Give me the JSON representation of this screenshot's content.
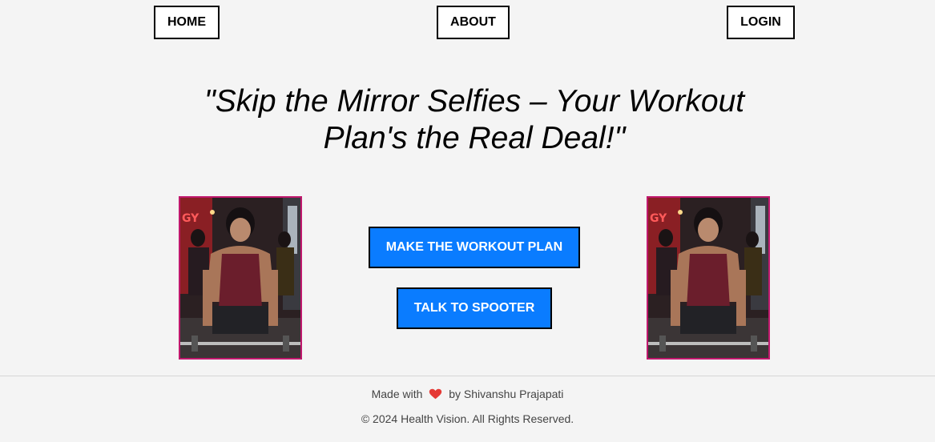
{
  "nav": {
    "home_label": "HOME",
    "about_label": "ABOUT",
    "login_label": "LOGIN"
  },
  "hero": {
    "tagline_line1": "\"Skip the Mirror Selfies – Your Workout",
    "tagline_line2": "Plan's the Real Deal!\""
  },
  "actions": {
    "make_plan_label": "MAKE THE WORKOUT PLAN",
    "talk_label": "TALK TO SPOOTER"
  },
  "footer": {
    "made_with": "Made with",
    "by_text": "by Shivanshu Prajapati",
    "copyright": "© 2024 Health Vision. All Rights Reserved."
  },
  "icons": {
    "heart": "heart-icon"
  },
  "colors": {
    "primary_button": "#0a7cff",
    "photo_border": "#c0186d",
    "heart": "#e53935"
  }
}
